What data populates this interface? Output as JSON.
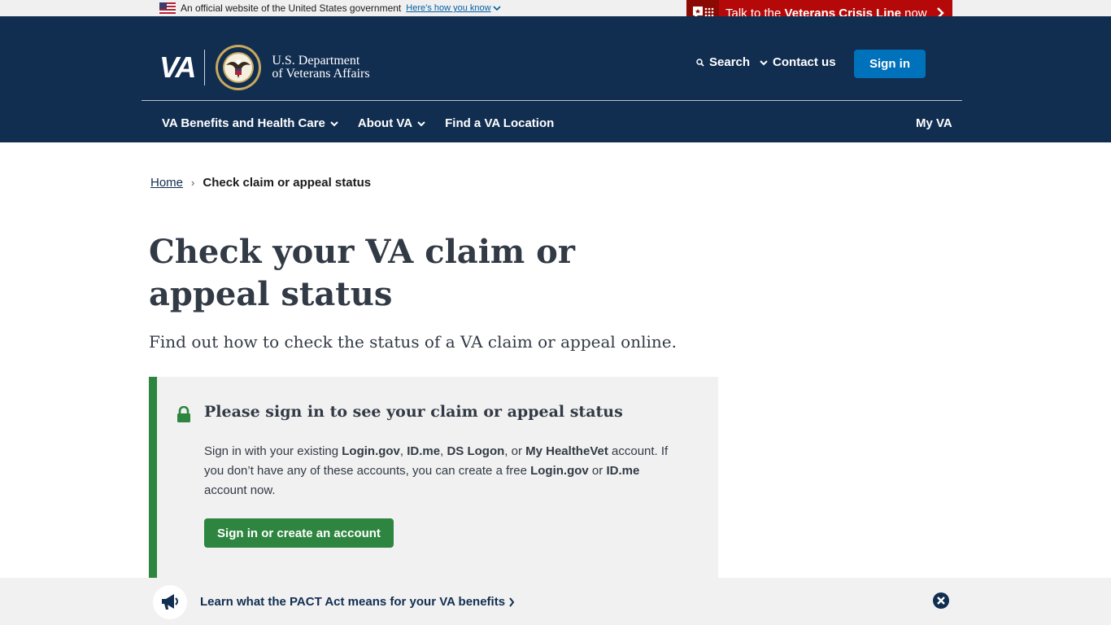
{
  "gov_banner": {
    "text": "An official website of the United States government",
    "link": "Here’s how you know"
  },
  "crisis_line": {
    "prefix": "Talk to the ",
    "bold": "Veterans Crisis Line",
    "suffix": " now"
  },
  "header": {
    "logo_mark": "VA",
    "dept_line1": "U.S. Department",
    "dept_line2": "of Veterans Affairs",
    "search_label": "Search",
    "contact_label": "Contact us",
    "signin_label": "Sign in"
  },
  "nav": {
    "items": [
      {
        "label": "VA Benefits and Health Care",
        "has_menu": true
      },
      {
        "label": "About VA",
        "has_menu": true
      },
      {
        "label": "Find a VA Location",
        "has_menu": false
      }
    ],
    "my_va": "My VA"
  },
  "breadcrumb": {
    "home": "Home",
    "separator": "›",
    "current": "Check claim or appeal status"
  },
  "main": {
    "title": "Check your VA claim or appeal status",
    "intro": "Find out how to check the status of a VA claim or appeal online."
  },
  "alert": {
    "heading": "Please sign in to see your claim or appeal status",
    "body_parts": {
      "p1": "Sign in with your existing ",
      "b1": "Login.gov",
      "p2": ", ",
      "b2": "ID.me",
      "p3": ", ",
      "b3": "DS Logon",
      "p4": ", or ",
      "b4": "My HealtheVet",
      "p5": " account. If you don’t have any of these accounts, you can create a free ",
      "b5": "Login.gov",
      "p6": " or ",
      "b6": "ID.me",
      "p7": " account now."
    },
    "button": "Sign in or create an account"
  },
  "promo": {
    "link": "Learn what the PACT Act means for your VA benefits"
  },
  "colors": {
    "header_bg": "#112e51",
    "crisis_red": "#b50909",
    "signin_blue": "#0071bb",
    "success_green": "#2e8540"
  }
}
